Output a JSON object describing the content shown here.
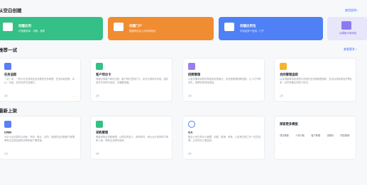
{
  "create": {
    "title": "从空白创建",
    "link": "使用说明 ›",
    "cards": [
      {
        "title": "创建应用",
        "desc": "可搭建表单、流程、报表",
        "color": "#34c086",
        "icon": "app-icon"
      },
      {
        "title": "创建门户",
        "desc": "搭建项目及公司内部首页",
        "color": "#f08c31",
        "icon": "portal-icon"
      },
      {
        "title": "创建应用包",
        "desc": "可包含多个应用、门户",
        "color": "#4f80f5",
        "icon": "package-icon"
      }
    ],
    "small": {
      "label": "从模板市场添加"
    }
  },
  "try_section": {
    "title": "推荐一试",
    "link": "查看更多 ›",
    "cards": [
      {
        "title": "任务追踪",
        "desc": "一站一问，一张卡片完成项目全流程的任务管理，任务中能查看，评价，总结，任务完成不遗漏清。",
        "meta": "3万",
        "color": "#5b7ff5",
        "icon": "task-icon"
      },
      {
        "title": "客户拜访卡",
        "desc": "快速记录客户拜访过程，客户拜访签到打卡，实时记录拜访内容，团队及时共享拜访信息，沟通更便捷。",
        "meta": "2万",
        "color": "#34c086",
        "icon": "visit-icon"
      },
      {
        "title": "招聘管理",
        "desc": "从发布需求到简历筛选到安排面试，全流程管理招聘进度，让人才不再流失，招聘效率持续提高。",
        "meta": "2万",
        "color": "#9a7ff0",
        "icon": "recruit-icon"
      },
      {
        "title": "合同管理追踪",
        "desc": "从合同起草审批到签约归档的全流程管理追踪，支持合同收款及开票记录，实时掌握合同执行情况。",
        "meta": "1万",
        "color": "#f5b52e",
        "icon": "contract-icon"
      }
    ]
  },
  "new_section": {
    "title": "最新上架",
    "cards": [
      {
        "title": "CRM",
        "desc": "为中小企业提供从线索、商机、报价、合同、回款的全流程客户管理，帮助企业提高销售效率和客户满意度。",
        "meta": "1万",
        "color": "#5b7ff5",
        "icon": "crm-icon"
      },
      {
        "title": "采购管理",
        "desc": "覆盖采购全流程管理，从供应商准入、采购申请、询价比价到采购订单和入库，帮助企业降本增效。",
        "meta": "8千",
        "color": "#34c086",
        "icon": "purchase-icon"
      },
      {
        "title": "OA",
        "desc": "集合公司日常办公管理，请假、报销、审批、公告等日常工作一站式处理，让协同办公更高效。",
        "meta": "6千",
        "color": "#4f80f5",
        "icon": "oa-icon"
      }
    ],
    "category_card": {
      "title": "探索更多模板",
      "tags": [
        "项目管理",
        "人事行政",
        "客户管理",
        "进销存",
        "财务报销"
      ],
      "more": "..."
    }
  }
}
